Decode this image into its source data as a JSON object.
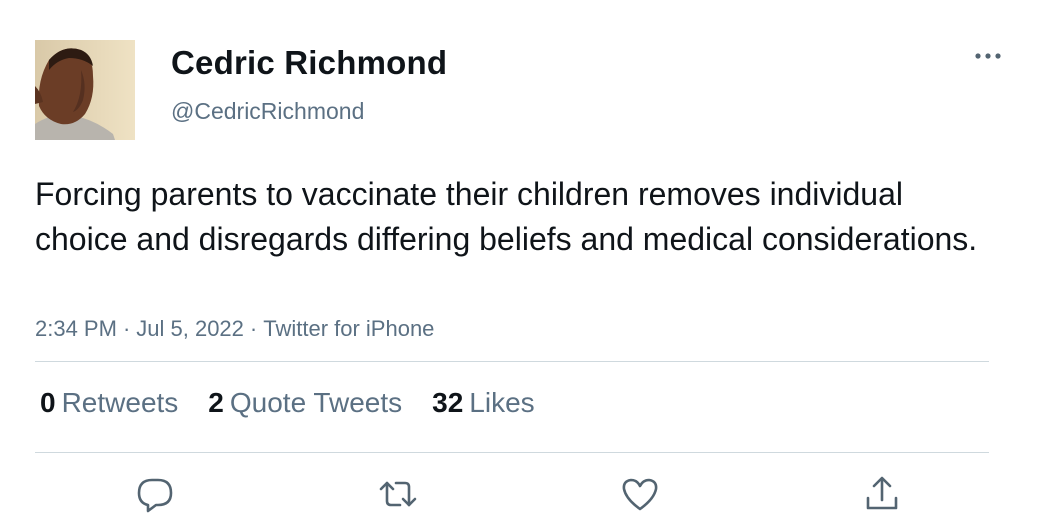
{
  "author": {
    "name": "Cedric Richmond",
    "handle": "@CedricRichmond"
  },
  "tweet": {
    "text": "Forcing parents to vaccinate their children removes individual choice and disregards differing beliefs and medical considerations.",
    "time": "2:34 PM",
    "date": "Jul 5, 2022",
    "source": "Twitter for iPhone",
    "separator": "·"
  },
  "stats": {
    "retweets": {
      "count": "0",
      "label": "Retweets"
    },
    "quote_tweets": {
      "count": "2",
      "label": "Quote Tweets"
    },
    "likes": {
      "count": "32",
      "label": "Likes"
    }
  },
  "icons": {
    "more": "more-dots-icon",
    "reply": "reply-icon",
    "retweet": "retweet-icon",
    "like": "heart-icon",
    "share": "share-icon"
  },
  "colors": {
    "text": "#0f1419",
    "secondary": "#5b7083",
    "divider": "#cfd9de",
    "icon": "#536471"
  }
}
